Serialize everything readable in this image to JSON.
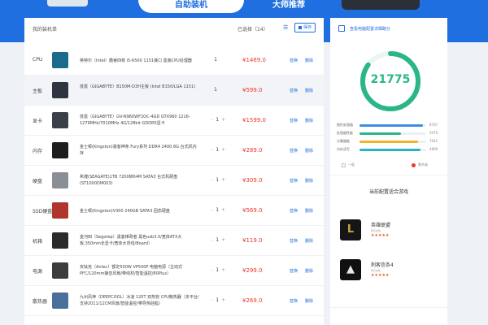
{
  "colors": {
    "accent": "#1f6fe0",
    "price": "#e8382e",
    "score": "#2ab68a",
    "stars": "#e8582e"
  },
  "tabs": [
    {
      "label": "自助装机",
      "active": true
    },
    {
      "label": "大师推荐",
      "active": false
    }
  ],
  "list": {
    "title": "我的装机单",
    "selected_count": "已选择（14）",
    "save_label": "保存",
    "menu_icon": "menu-lines-icon"
  },
  "components": [
    {
      "category": "CPU",
      "name": "英特尔（Intel）酷睿四核 i5-6500 1151接口 盒装CPU处理器",
      "qty": "1",
      "has_stepper": false,
      "price": "¥1469.0",
      "thumb_color": "#1b6b8c",
      "highlight": false
    },
    {
      "category": "主板",
      "name": "技嘉（GIGABYTE）B150M-D3H主板 (Intel B150/LGA 1151)",
      "qty": "1",
      "has_stepper": false,
      "price": "¥599.0",
      "thumb_color": "#2f3540",
      "highlight": true
    },
    {
      "category": "显卡",
      "name": "技嘉（GIGABYTE）GV-N960WF2OC-4GD GTX960 1216-1279MHz/7010MHz 4G/128bit GDDR5显卡",
      "qty": "1",
      "has_stepper": true,
      "price": "¥1599.0",
      "thumb_color": "#3a3f48",
      "highlight": false
    },
    {
      "category": "内存",
      "name": "金士顿(Kingston)骇客神条 Fury系列 DDR4 2400 8G 台式机内存",
      "qty": "1",
      "has_stepper": true,
      "price": "¥289.0",
      "thumb_color": "#1e1e1e",
      "highlight": false
    },
    {
      "category": "硬盘",
      "name": "希捷(SEAGATE)1TB 7200转64M SATA3 台式机硬盘(ST1000DM003)",
      "qty": "1",
      "has_stepper": true,
      "price": "¥309.0",
      "thumb_color": "#8a8f96",
      "highlight": false
    },
    {
      "category": "SSD硬盘",
      "name": "金士顿(Kingston)V300 240GB SATA3 固态硬盘",
      "qty": "1",
      "has_stepper": true,
      "price": "¥569.0",
      "thumb_color": "#b0362c",
      "highlight": false
    },
    {
      "category": "机箱",
      "name": "金河田（Segotep）黑客律政者 黑色usb3.0/宽体ATX大板,350mm长显卡/宽体大背线/Board）",
      "qty": "1",
      "has_stepper": true,
      "price": "¥119.0",
      "thumb_color": "#2b2b2b",
      "highlight": false
    },
    {
      "category": "电源",
      "name": "安钛克（Antec）额定500W VP500P 电脑电源（主动式PFC/120mm静音风扇/带线材/智能温控/80Plus）",
      "qty": "1",
      "has_stepper": true,
      "price": "¥299.0",
      "thumb_color": "#3c3c3c",
      "highlight": false
    },
    {
      "category": "散热器",
      "name": "九州风神（DEEPCOOL）冰凌 120T 双热管 CPU散热器（多平台/支持2011/12CM风扇/智能温控/带导热硅脂）",
      "qty": "1",
      "has_stepper": true,
      "price": "¥269.0",
      "thumb_color": "#4a6f9c",
      "highlight": false
    }
  ],
  "row_actions": {
    "a": "替换",
    "b": "删除"
  },
  "score_panel": {
    "detail_link": "查看电脑配置详细跑分",
    "score": "21775",
    "score_fraction": 0.85,
    "bars": [
      {
        "label": "图形处理器",
        "value": "8767",
        "fraction": 0.95,
        "color": "#3d8be6"
      },
      {
        "label": "处理器性能",
        "value": "2070",
        "fraction": 0.62,
        "color": "#2ab68a"
      },
      {
        "label": "计算器能",
        "value": "7042",
        "fraction": 0.88,
        "color": "#f0b429"
      },
      {
        "label": "内存读写",
        "value": "4896",
        "fraction": 0.92,
        "color": "#26b5c8"
      }
    ],
    "legend_normal": "一般",
    "legend_mark": "需升级",
    "games_title": "当前配置适合游戏",
    "games": [
      {
        "title": "英雄联盟",
        "subtitle": "畅玩指数",
        "stars": "★★★★★",
        "icon_letter": "L",
        "icon_bg": "#151515",
        "icon_fg": "#c8a544"
      },
      {
        "title": "刺客信条4",
        "subtitle": "畅玩指数",
        "stars": "★★★★★",
        "icon_letter": "▲",
        "icon_bg": "#101010",
        "icon_fg": "#e8e8e8"
      }
    ]
  }
}
